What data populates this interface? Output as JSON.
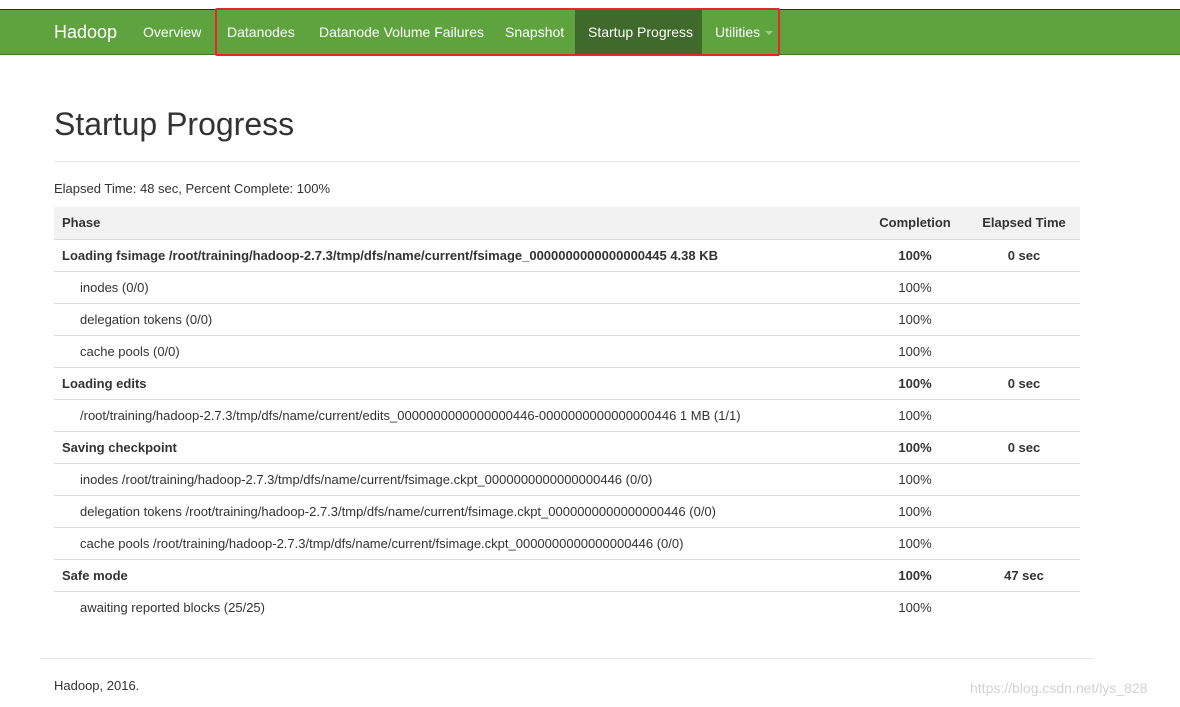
{
  "navbar": {
    "brand": "Hadoop",
    "items": [
      {
        "label": "Overview"
      },
      {
        "label": "Datanodes"
      },
      {
        "label": "Datanode Volume Failures"
      },
      {
        "label": "Snapshot"
      },
      {
        "label": "Startup Progress"
      },
      {
        "label": "Utilities"
      }
    ]
  },
  "page": {
    "title": "Startup Progress",
    "summary": "Elapsed Time: 48 sec, Percent Complete: 100%"
  },
  "table": {
    "headers": {
      "phase": "Phase",
      "completion": "Completion",
      "elapsed": "Elapsed Time"
    },
    "rows": [
      {
        "phase": "Loading fsimage /root/training/hadoop-2.7.3/tmp/dfs/name/current/fsimage_0000000000000000445 4.38 KB",
        "completion": "100%",
        "elapsed": "0 sec"
      },
      {
        "phase": "inodes (0/0)",
        "completion": "100%",
        "elapsed": ""
      },
      {
        "phase": "delegation tokens (0/0)",
        "completion": "100%",
        "elapsed": ""
      },
      {
        "phase": "cache pools (0/0)",
        "completion": "100%",
        "elapsed": ""
      },
      {
        "phase": "Loading edits",
        "completion": "100%",
        "elapsed": "0 sec"
      },
      {
        "phase": "/root/training/hadoop-2.7.3/tmp/dfs/name/current/edits_0000000000000000446-0000000000000000446 1 MB (1/1)",
        "completion": "100%",
        "elapsed": ""
      },
      {
        "phase": "Saving checkpoint",
        "completion": "100%",
        "elapsed": "0 sec"
      },
      {
        "phase": "inodes /root/training/hadoop-2.7.3/tmp/dfs/name/current/fsimage.ckpt_0000000000000000446 (0/0)",
        "completion": "100%",
        "elapsed": ""
      },
      {
        "phase": "delegation tokens /root/training/hadoop-2.7.3/tmp/dfs/name/current/fsimage.ckpt_0000000000000000446 (0/0)",
        "completion": "100%",
        "elapsed": ""
      },
      {
        "phase": "cache pools /root/training/hadoop-2.7.3/tmp/dfs/name/current/fsimage.ckpt_0000000000000000446 (0/0)",
        "completion": "100%",
        "elapsed": ""
      },
      {
        "phase": "Safe mode",
        "completion": "100%",
        "elapsed": "47 sec"
      },
      {
        "phase": "awaiting reported blocks (25/25)",
        "completion": "100%",
        "elapsed": ""
      }
    ]
  },
  "footer": {
    "text": "Hadoop, 2016."
  },
  "watermark": "https://blog.csdn.net/lys_828",
  "colors": {
    "navbar": "#5fa33e",
    "active_tab": "#3f6a2c",
    "highlight": "#e8262a"
  }
}
